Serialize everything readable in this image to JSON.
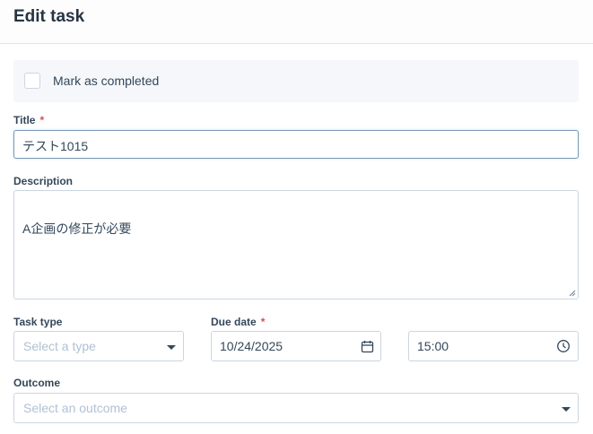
{
  "header": {
    "title": "Edit task"
  },
  "completed": {
    "label": "Mark as completed",
    "checked": false
  },
  "title_field": {
    "label": "Title",
    "required_mark": "*",
    "value": "テスト1015"
  },
  "description_field": {
    "label": "Description",
    "value": "A企画の修正が必要"
  },
  "task_type_field": {
    "label": "Task type",
    "placeholder": "Select a type"
  },
  "due_date_field": {
    "label": "Due date",
    "required_mark": "*",
    "date_value": "10/24/2025",
    "time_value": "15:00"
  },
  "outcome_field": {
    "label": "Outcome",
    "placeholder": "Select an outcome"
  },
  "icons": {
    "date": "calendar-icon",
    "time": "clock-icon",
    "dropdown": "chevron-down-icon"
  }
}
